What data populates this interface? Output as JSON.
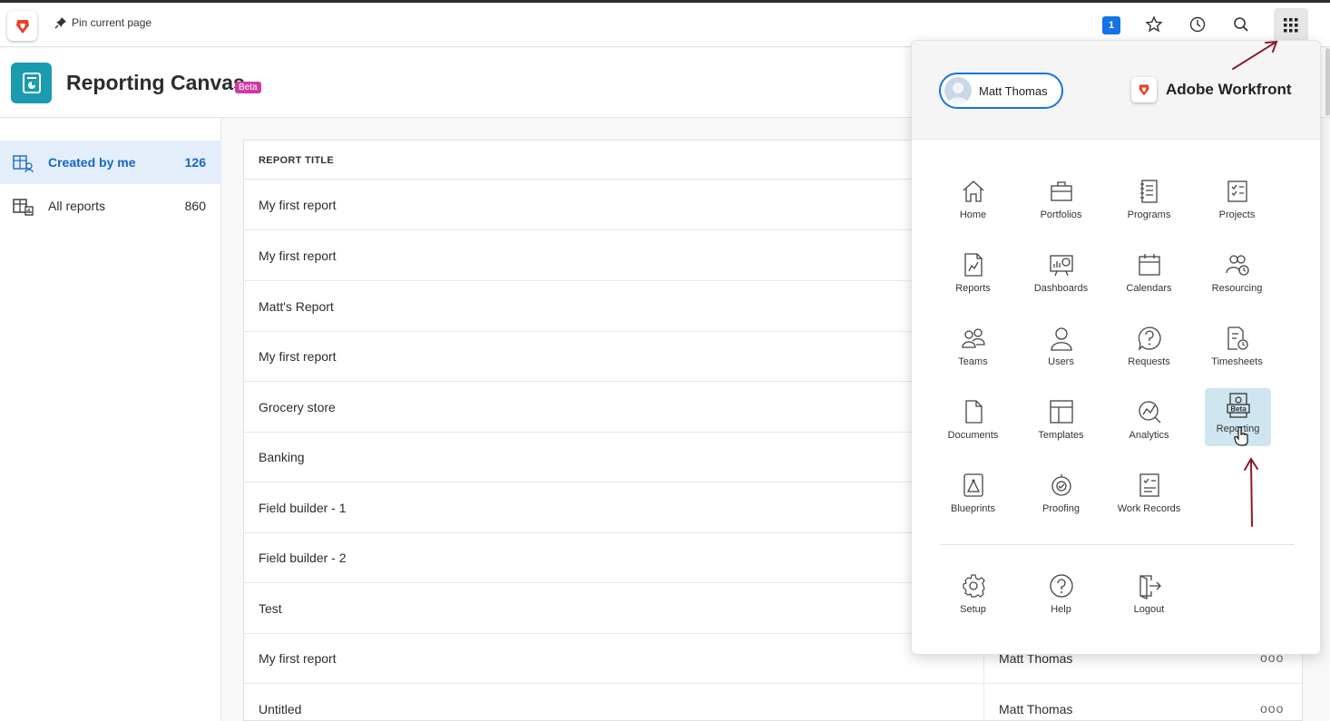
{
  "browser": {
    "pin_label": "Pin current page",
    "notification_count": "1"
  },
  "header": {
    "title": "Reporting Canvas",
    "beta": "Beta"
  },
  "sidebar": {
    "items": [
      {
        "label": "Created by me",
        "count": "126",
        "active": true
      },
      {
        "label": "All reports",
        "count": "860",
        "active": false
      }
    ]
  },
  "table": {
    "column_title": "REPORT TITLE",
    "rows": [
      {
        "title": "My first report",
        "owner": ""
      },
      {
        "title": "My first report",
        "owner": ""
      },
      {
        "title": "Matt's Report",
        "owner": ""
      },
      {
        "title": "My first report",
        "owner": ""
      },
      {
        "title": "Grocery store",
        "owner": ""
      },
      {
        "title": "Banking",
        "owner": ""
      },
      {
        "title": "Field builder - 1",
        "owner": ""
      },
      {
        "title": "Field builder - 2",
        "owner": ""
      },
      {
        "title": "Test",
        "owner": ""
      },
      {
        "title": "My first report",
        "owner": "Matt Thomas"
      },
      {
        "title": "Untitled",
        "owner": "Matt Thomas"
      }
    ],
    "more": "ooo"
  },
  "panel": {
    "user_name": "Matt Thomas",
    "brand": "Adobe Workfront",
    "apps": [
      {
        "label": "Home",
        "icon": "home-icon"
      },
      {
        "label": "Portfolios",
        "icon": "portfolio-icon"
      },
      {
        "label": "Programs",
        "icon": "programs-icon"
      },
      {
        "label": "Projects",
        "icon": "projects-icon"
      },
      {
        "label": "Reports",
        "icon": "reports-icon"
      },
      {
        "label": "Dashboards",
        "icon": "dashboards-icon"
      },
      {
        "label": "Calendars",
        "icon": "calendar-icon"
      },
      {
        "label": "Resourcing",
        "icon": "resourcing-icon"
      },
      {
        "label": "Teams",
        "icon": "teams-icon"
      },
      {
        "label": "Users",
        "icon": "user-icon"
      },
      {
        "label": "Requests",
        "icon": "requests-icon"
      },
      {
        "label": "Timesheets",
        "icon": "timesheets-icon"
      },
      {
        "label": "Documents",
        "icon": "document-icon"
      },
      {
        "label": "Templates",
        "icon": "templates-icon"
      },
      {
        "label": "Analytics",
        "icon": "analytics-icon"
      },
      {
        "label": "Reporting",
        "icon": "reporting-icon",
        "badge": "Beta"
      },
      {
        "label": "Blueprints",
        "icon": "blueprints-icon"
      },
      {
        "label": "Proofing",
        "icon": "proofing-icon"
      },
      {
        "label": "Work Records",
        "icon": "work-records-icon"
      }
    ],
    "footer": [
      {
        "label": "Setup",
        "icon": "gear-icon"
      },
      {
        "label": "Help",
        "icon": "help-icon"
      },
      {
        "label": "Logout",
        "icon": "logout-icon"
      }
    ]
  },
  "colors": {
    "accent": "#1473e6",
    "app_teal": "#1a9bb0",
    "beta_pink": "#d13aa3",
    "annotation": "#8b1a2e"
  }
}
